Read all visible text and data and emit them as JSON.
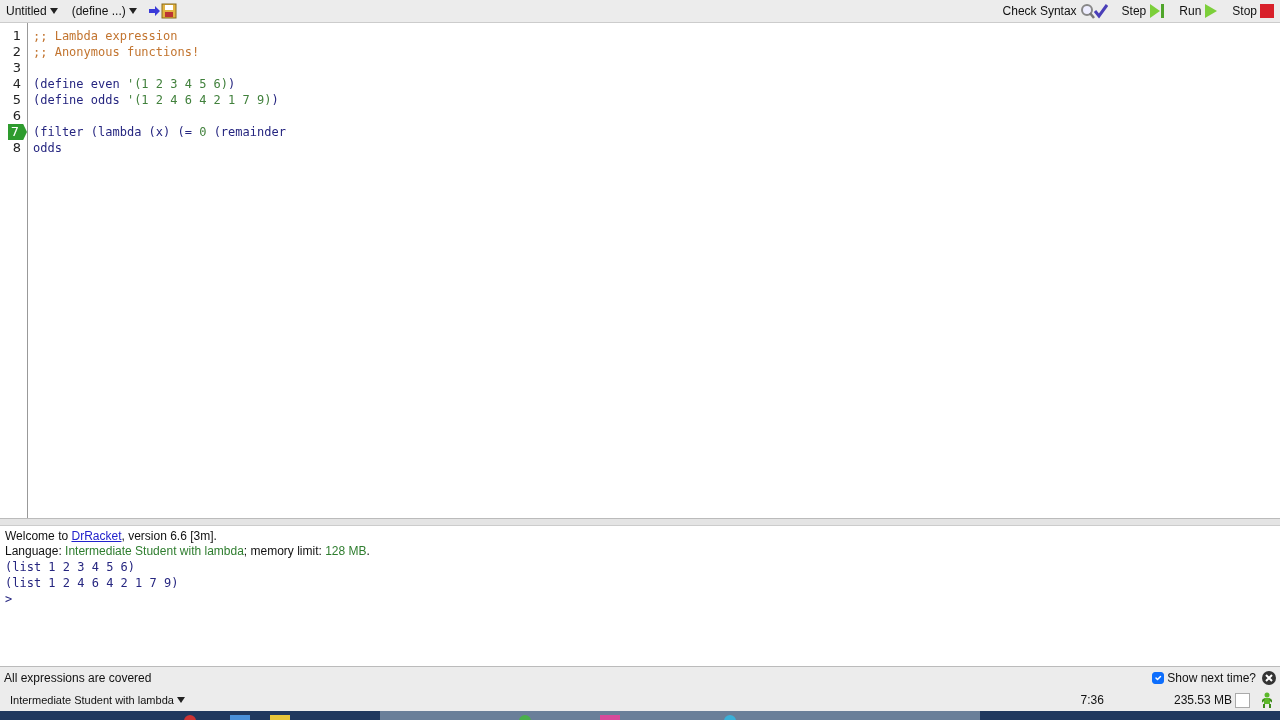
{
  "toolbar": {
    "file_menu": "Untitled",
    "define_menu": "(define ...)",
    "buttons": [
      {
        "label": "Check Syntax",
        "kind": "check"
      },
      {
        "label": "Step",
        "kind": "step"
      },
      {
        "label": "Run",
        "kind": "run"
      },
      {
        "label": "Stop",
        "kind": "stop"
      }
    ]
  },
  "editor": {
    "lines": [
      {
        "number": "1",
        "current": false,
        "tokens": [
          {
            "text": ";; Lambda expression",
            "kind": "comment"
          }
        ]
      },
      {
        "number": "2",
        "current": false,
        "tokens": [
          {
            "text": ";; Anonymous functions!",
            "kind": "comment"
          }
        ]
      },
      {
        "number": "3",
        "current": false
      },
      {
        "number": "4",
        "current": false,
        "tokens": [
          {
            "text": "(define even ",
            "kind": "symbol"
          },
          {
            "text": "'(1 2 3 4 5 6)",
            "kind": "constant"
          },
          {
            "text": ")",
            "kind": "symbol"
          }
        ]
      },
      {
        "number": "5",
        "current": false,
        "tokens": [
          {
            "text": "(define odds ",
            "kind": "symbol"
          },
          {
            "text": "'(1 2 4 6 4 2 1 7 9)",
            "kind": "constant"
          },
          {
            "text": ")",
            "kind": "symbol"
          }
        ]
      },
      {
        "number": "6",
        "current": false
      },
      {
        "number": "7",
        "current": true,
        "tokens": [
          {
            "text": "(filter (lambda (x) (= ",
            "kind": "symbol"
          },
          {
            "text": "0",
            "kind": "constant"
          },
          {
            "text": " (remainder",
            "kind": "symbol"
          }
        ]
      },
      {
        "number": "8",
        "current": false,
        "tokens": [
          {
            "text": "odds",
            "kind": "symbol"
          }
        ]
      }
    ]
  },
  "repl": {
    "welcome": [
      {
        "text": "Welcome to ",
        "kind": "plain"
      },
      {
        "text": "DrRacket",
        "kind": "link"
      },
      {
        "text": ", version 6.6 [3m].",
        "kind": "plain"
      }
    ],
    "language": [
      {
        "text": "Language: ",
        "kind": "plain"
      },
      {
        "text": "Intermediate Student with lambda",
        "kind": "value"
      },
      {
        "text": "; memory limit: ",
        "kind": "plain"
      },
      {
        "text": "128 MB",
        "kind": "value"
      },
      {
        "text": ".",
        "kind": "plain"
      }
    ],
    "outputs": [
      "(list 1 2 3 4 5 6)",
      "(list 1 2 4 6 4 2 1 7 9)"
    ],
    "prompt": ">"
  },
  "coverage": {
    "message": "All expressions are covered",
    "show_next_time": {
      "label": "Show next time?",
      "checked": true
    }
  },
  "status_bar": {
    "language": "Intermediate Student with lambda",
    "position": "7:36",
    "memory": "235.53 MB"
  }
}
